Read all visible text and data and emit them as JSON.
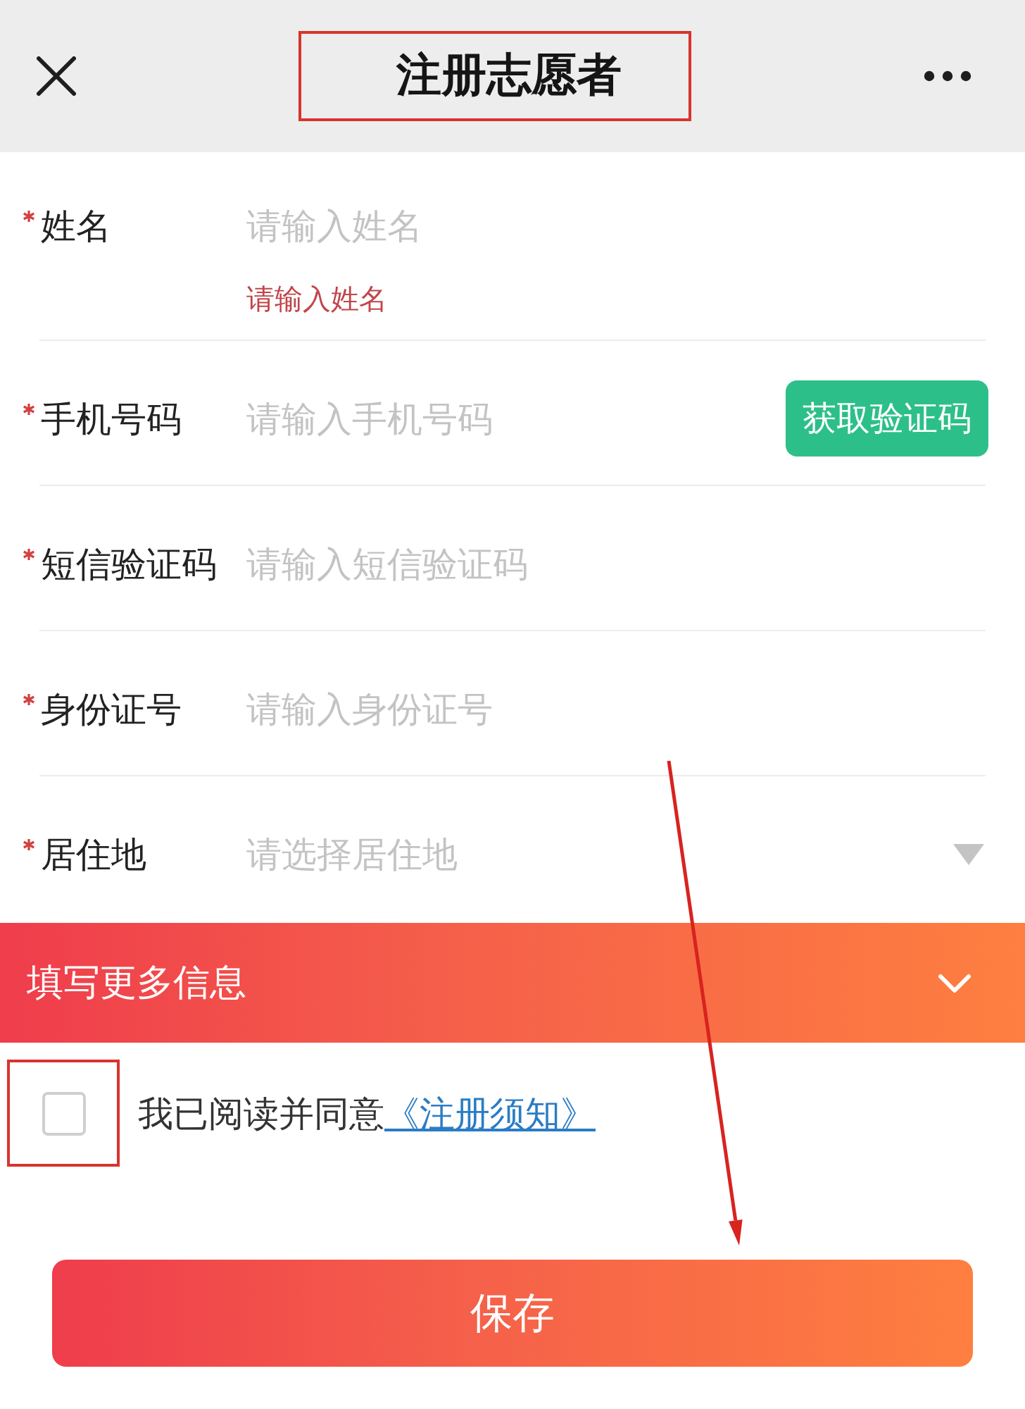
{
  "header": {
    "title": "注册志愿者"
  },
  "fields": [
    {
      "label": "姓名",
      "required": true,
      "kind": "text",
      "placeholder": "请输入姓名",
      "error": "请输入姓名"
    },
    {
      "label": "手机号码",
      "required": true,
      "kind": "text",
      "placeholder": "请输入手机号码",
      "button": "获取验证码"
    },
    {
      "label": "短信验证码",
      "required": true,
      "kind": "text",
      "placeholder": "请输入短信验证码"
    },
    {
      "label": "身份证号",
      "required": true,
      "kind": "text",
      "placeholder": "请输入身份证号"
    },
    {
      "label": "居住地",
      "required": true,
      "kind": "select",
      "placeholder": "请选择居住地"
    }
  ],
  "more_info": {
    "label": "填写更多信息",
    "expanded": false
  },
  "agreement": {
    "checked": false,
    "text": "我已阅读并同意",
    "link": "《注册须知》"
  },
  "save_button": "保存"
}
